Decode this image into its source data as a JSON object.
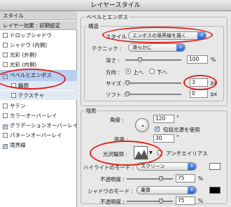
{
  "window": {
    "title": "レイヤースタイル"
  },
  "sidebar": {
    "header_style": "スタイル",
    "header_blend": "レイヤー効果 : 初期設定",
    "items": [
      {
        "label": "ドロップシャドウ",
        "checked": false
      },
      {
        "label": "シャドウ (内側)",
        "checked": false
      },
      {
        "label": "光彩 (外側)",
        "checked": false
      },
      {
        "label": "光彩 (内側)",
        "checked": false
      },
      {
        "label": "ベベルとエンボス",
        "checked": true
      },
      {
        "label": "輪郭",
        "checked": false
      },
      {
        "label": "テクスチャ",
        "checked": false
      },
      {
        "label": "サテン",
        "checked": false
      },
      {
        "label": "カラーオーバーレイ",
        "checked": false
      },
      {
        "label": "グラデーションオーバーレイ",
        "checked": true
      },
      {
        "label": "パターンオーバーレイ",
        "checked": false
      },
      {
        "label": "境界線",
        "checked": true
      }
    ]
  },
  "bevel": {
    "section_title": "ベベルとエンボス",
    "structure_title": "構造",
    "style_label": "スタイル :",
    "style_value": "エンボスの境界線を描く",
    "technique_label": "テクニック :",
    "technique_value": "滑らかに",
    "depth_label": "深さ :",
    "depth_value": "100",
    "depth_unit": "%",
    "direction_label": "方向 :",
    "direction_up": "上へ",
    "direction_down": "下へ",
    "size_label": "サイズ :",
    "size_value": "3",
    "size_unit": "px",
    "soften_label": "ソフト :",
    "soften_value": "0",
    "soften_unit": "px"
  },
  "shading": {
    "title": "陰影",
    "angle_label": "角度 :",
    "angle_value": "120",
    "angle_unit": "°",
    "global_light_label": "包括光源を使用",
    "altitude_label": "高度 :",
    "altitude_value": "30",
    "altitude_unit": "°",
    "gloss_label": "光沢輪郭 :",
    "antialias_label": "アンチエイリアス",
    "highlight_label": "ハイライトのモード :",
    "highlight_value": "スクリーン",
    "highlight_color": "#ffffff",
    "opacity1_label": "不透明度 :",
    "opacity1_value": "75",
    "opacity1_unit": "%",
    "shadow_label": "シャドウのモード :",
    "shadow_value": "乗算",
    "shadow_color": "#000000",
    "opacity2_label": "不透明度 :",
    "opacity2_value": "75",
    "opacity2_unit": "%"
  },
  "highlight_marks": {
    "color": "#e2231a"
  }
}
